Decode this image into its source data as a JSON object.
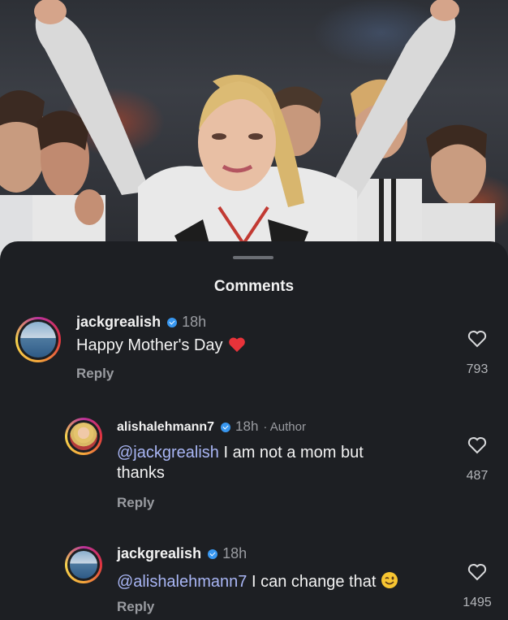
{
  "sheet": {
    "title": "Comments"
  },
  "comments": [
    {
      "username": "jackgrealish",
      "time": "18h",
      "author_tag": "",
      "mention": "",
      "text": "Happy Mother's Day",
      "emoji": "red-heart",
      "reply": "Reply",
      "likes": "793"
    },
    {
      "username": "alishalehmann7",
      "time": "18h",
      "author_tag": "· Author",
      "mention": "@jackgrealish",
      "text_line1": " I am not a mom but",
      "text_line2": "thanks",
      "reply": "Reply",
      "likes": "487"
    },
    {
      "username": "jackgrealish",
      "time": "18h",
      "author_tag": "",
      "mention": "@alishalehmann7",
      "text": " I can change that",
      "emoji": "winking-face",
      "reply": "Reply",
      "likes": "1495"
    }
  ],
  "colors": {
    "background": "#1d1f23",
    "mention": "#a9b6f5",
    "verified": "#3897f0",
    "heart": "#e8333a"
  }
}
